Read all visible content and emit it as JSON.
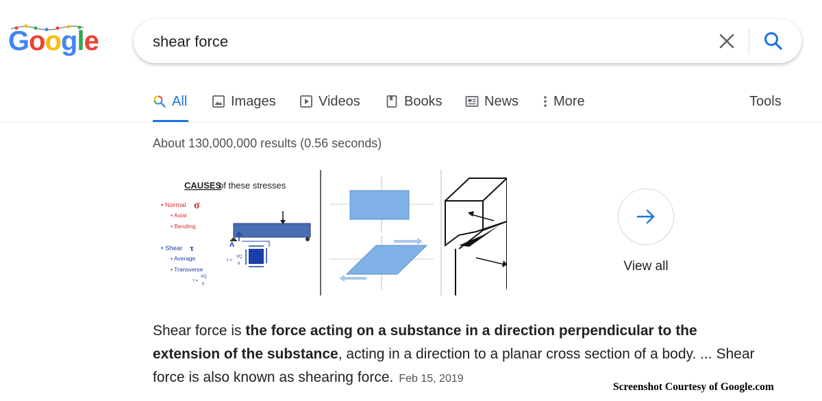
{
  "logo": {
    "text": "Google",
    "letters": [
      "G",
      "o",
      "o",
      "g",
      "l",
      "e"
    ],
    "colors": [
      "#4285f4",
      "#ea4335",
      "#fbbc05",
      "#4285f4",
      "#34a853",
      "#ea4335"
    ]
  },
  "search": {
    "query": "shear force",
    "clear_icon": "close-icon",
    "search_icon": "search-icon"
  },
  "tabs": [
    {
      "label": "All",
      "icon": "search-icon",
      "active": true
    },
    {
      "label": "Images",
      "icon": "image-icon"
    },
    {
      "label": "Videos",
      "icon": "play-icon"
    },
    {
      "label": "Books",
      "icon": "book-icon"
    },
    {
      "label": "News",
      "icon": "newspaper-icon"
    },
    {
      "label": "More",
      "icon": "more-vert-icon"
    }
  ],
  "tools_label": "Tools",
  "result_stats": "About 130,000,000 results (0.56 seconds)",
  "images": {
    "thumb1": {
      "title_underlined": "CAUSES",
      "title_rest": " of these stresses",
      "lines": [
        "• Normal",
        "• Axial",
        "• Bending",
        "• Shear",
        "• Average",
        "• Transverse"
      ],
      "sigma": "σ",
      "tau": "τ",
      "labels": [
        "A",
        "VQ",
        "It",
        "τ =",
        "τ ="
      ]
    },
    "view_all_label": "View all"
  },
  "snippet": {
    "part1": "Shear force is ",
    "bold": "the force acting on a substance in a direction perpendicular to the extension of the substance",
    "part2": ", acting in a direction to a planar cross section of a body. ... Shear force is also known as shearing force.",
    "date": "Feb 15, 2019"
  },
  "courtesy": "Screenshot Courtesy of Google.com",
  "colors": {
    "accent": "#1a73e8",
    "text": "#202124",
    "muted": "#4d5156"
  }
}
